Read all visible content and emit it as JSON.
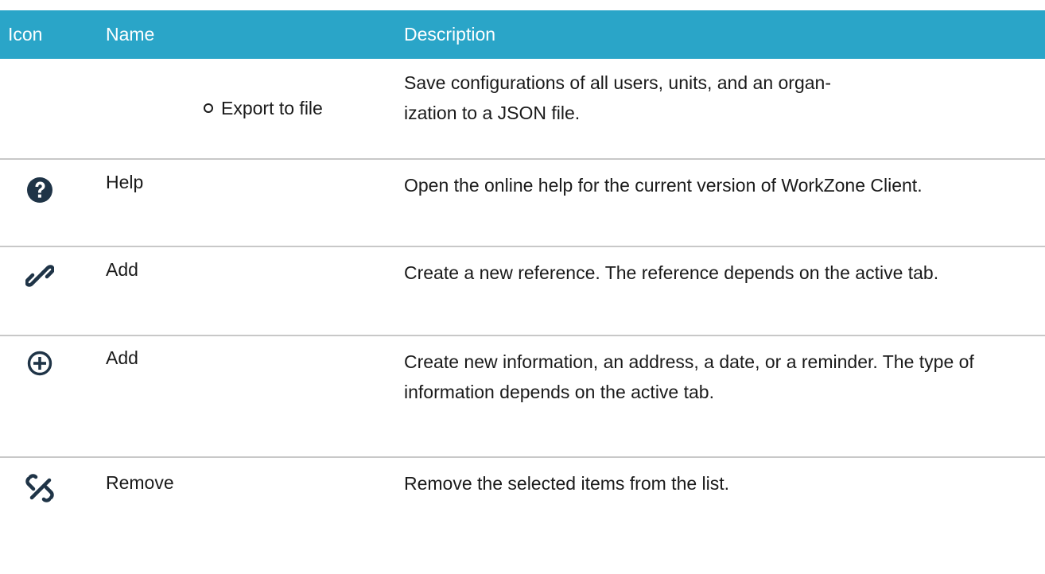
{
  "table": {
    "headers": {
      "icon": "Icon",
      "name": "Name",
      "description": "Description"
    },
    "rows": [
      {
        "icon": "",
        "name": "Export to file",
        "bulleted": true,
        "description": "Save configurations of all users, units, and an organ-\nization to a JSON file."
      },
      {
        "icon": "help-icon",
        "name": "Help",
        "description": "Open the online help for the current version of WorkZone Client."
      },
      {
        "icon": "link-icon",
        "name": "Add",
        "description": "Create a new reference. The reference depends on the active tab."
      },
      {
        "icon": "plus-circle-icon",
        "name": "Add",
        "description": "Create new information, an address, a date, or a reminder. The type of information depends on the active tab."
      },
      {
        "icon": "unlink-icon",
        "name": "Remove",
        "description": "Remove the selected items from the list."
      }
    ]
  },
  "colors": {
    "header_bg": "#2aa5c8",
    "header_text": "#ffffff",
    "divider": "#c8c8c8",
    "icon": "#1f3447"
  }
}
